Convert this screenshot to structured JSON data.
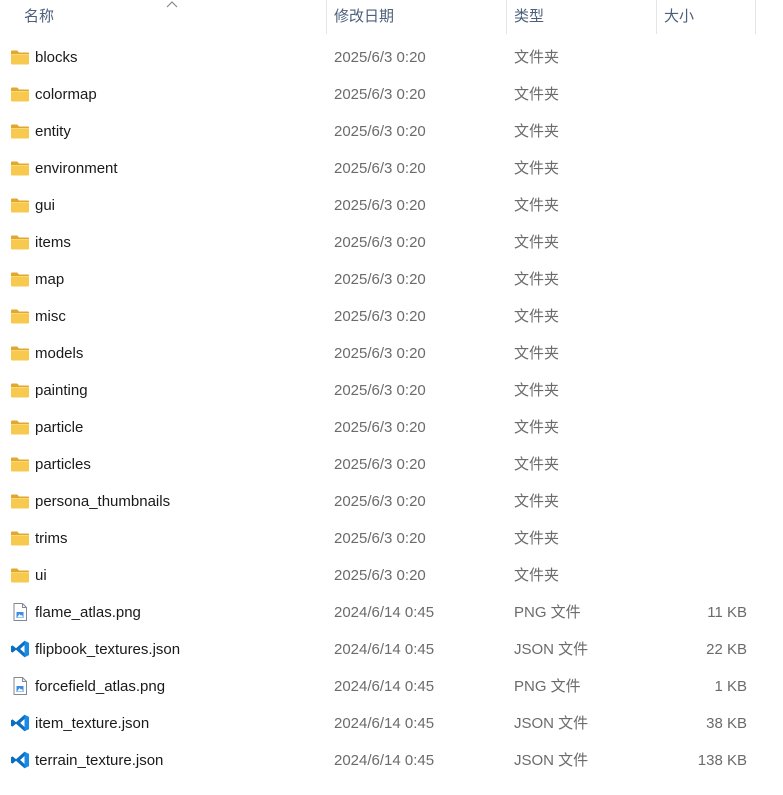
{
  "columns": {
    "name": "名称",
    "date": "修改日期",
    "type": "类型",
    "size": "大小"
  },
  "colors": {
    "header_text": "#4c607a",
    "folder": "#f2c14e",
    "vscode": "#0a6fc4"
  },
  "files": [
    {
      "name": "blocks",
      "date": "2025/6/3 0:20",
      "type": "文件夹",
      "size": "",
      "icon": "folder-icon"
    },
    {
      "name": "colormap",
      "date": "2025/6/3 0:20",
      "type": "文件夹",
      "size": "",
      "icon": "folder-icon"
    },
    {
      "name": "entity",
      "date": "2025/6/3 0:20",
      "type": "文件夹",
      "size": "",
      "icon": "folder-icon"
    },
    {
      "name": "environment",
      "date": "2025/6/3 0:20",
      "type": "文件夹",
      "size": "",
      "icon": "folder-icon"
    },
    {
      "name": "gui",
      "date": "2025/6/3 0:20",
      "type": "文件夹",
      "size": "",
      "icon": "folder-icon"
    },
    {
      "name": "items",
      "date": "2025/6/3 0:20",
      "type": "文件夹",
      "size": "",
      "icon": "folder-icon"
    },
    {
      "name": "map",
      "date": "2025/6/3 0:20",
      "type": "文件夹",
      "size": "",
      "icon": "folder-icon"
    },
    {
      "name": "misc",
      "date": "2025/6/3 0:20",
      "type": "文件夹",
      "size": "",
      "icon": "folder-icon"
    },
    {
      "name": "models",
      "date": "2025/6/3 0:20",
      "type": "文件夹",
      "size": "",
      "icon": "folder-icon"
    },
    {
      "name": "painting",
      "date": "2025/6/3 0:20",
      "type": "文件夹",
      "size": "",
      "icon": "folder-icon"
    },
    {
      "name": "particle",
      "date": "2025/6/3 0:20",
      "type": "文件夹",
      "size": "",
      "icon": "folder-icon"
    },
    {
      "name": "particles",
      "date": "2025/6/3 0:20",
      "type": "文件夹",
      "size": "",
      "icon": "folder-icon"
    },
    {
      "name": "persona_thumbnails",
      "date": "2025/6/3 0:20",
      "type": "文件夹",
      "size": "",
      "icon": "folder-icon"
    },
    {
      "name": "trims",
      "date": "2025/6/3 0:20",
      "type": "文件夹",
      "size": "",
      "icon": "folder-icon"
    },
    {
      "name": "ui",
      "date": "2025/6/3 0:20",
      "type": "文件夹",
      "size": "",
      "icon": "folder-icon"
    },
    {
      "name": "flame_atlas.png",
      "date": "2024/6/14 0:45",
      "type": "PNG 文件",
      "size": "11 KB",
      "icon": "png-file-icon"
    },
    {
      "name": "flipbook_textures.json",
      "date": "2024/6/14 0:45",
      "type": "JSON 文件",
      "size": "22 KB",
      "icon": "vscode-json-icon"
    },
    {
      "name": "forcefield_atlas.png",
      "date": "2024/6/14 0:45",
      "type": "PNG 文件",
      "size": "1 KB",
      "icon": "png-file-icon"
    },
    {
      "name": "item_texture.json",
      "date": "2024/6/14 0:45",
      "type": "JSON 文件",
      "size": "38 KB",
      "icon": "vscode-json-icon"
    },
    {
      "name": "terrain_texture.json",
      "date": "2024/6/14 0:45",
      "type": "JSON 文件",
      "size": "138 KB",
      "icon": "vscode-json-icon"
    }
  ]
}
